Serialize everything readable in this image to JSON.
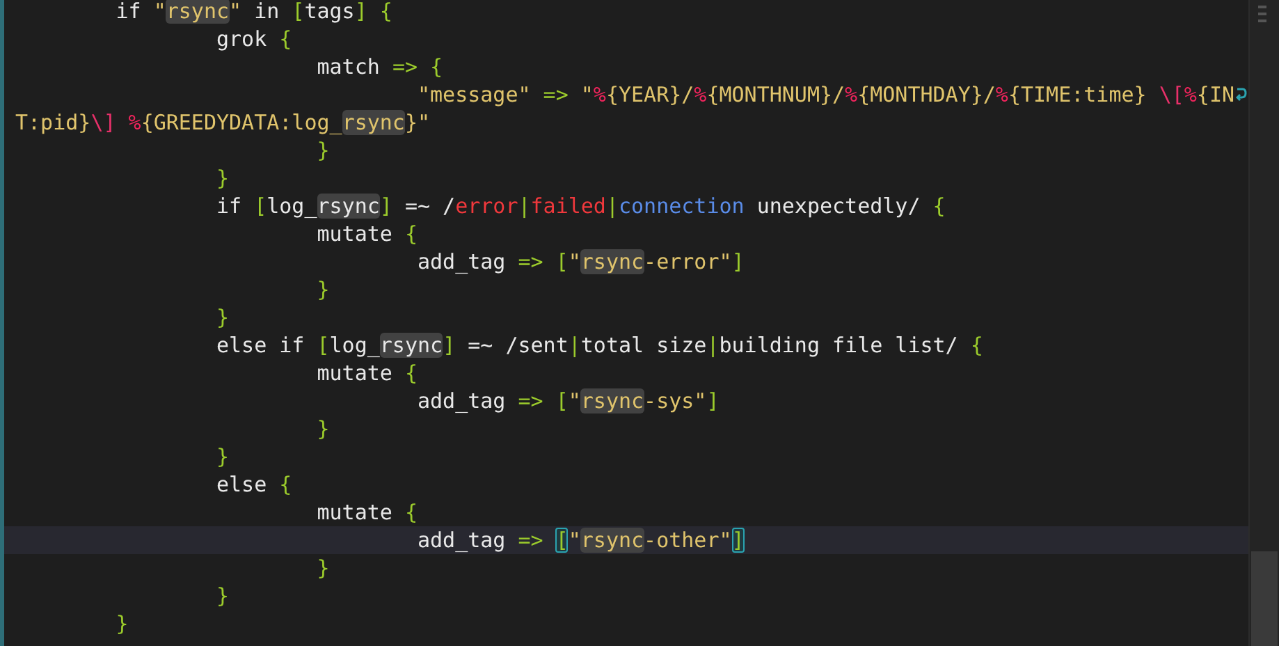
{
  "editor": {
    "lines": [
      {
        "segments": [
          {
            "text": "\tif ",
            "kind": "plain"
          },
          {
            "text": "\"",
            "kind": "string"
          },
          {
            "text": "rsync",
            "kind": "string",
            "highlight": true
          },
          {
            "text": "\"",
            "kind": "string"
          },
          {
            "text": " in ",
            "kind": "plain"
          },
          {
            "text": "[",
            "kind": "punct"
          },
          {
            "text": "tags",
            "kind": "plain"
          },
          {
            "text": "]",
            "kind": "punct"
          },
          {
            "text": " {",
            "kind": "punct"
          }
        ]
      },
      {
        "segments": [
          {
            "text": "\t\tgrok ",
            "kind": "plain"
          },
          {
            "text": "{",
            "kind": "punct"
          }
        ]
      },
      {
        "segments": [
          {
            "text": "\t\t\tmatch ",
            "kind": "plain"
          },
          {
            "text": "=>",
            "kind": "punct"
          },
          {
            "text": " {",
            "kind": "punct"
          }
        ]
      },
      {
        "wrapped": true,
        "segments": [
          {
            "text": "\t\t\t\t\"message\"",
            "kind": "string"
          },
          {
            "text": " =>",
            "kind": "punct"
          },
          {
            "text": " \"",
            "kind": "string"
          },
          {
            "text": "%",
            "kind": "percent"
          },
          {
            "text": "{YEAR}/",
            "kind": "string"
          },
          {
            "text": "%",
            "kind": "percent"
          },
          {
            "text": "{MONTHNUM}/",
            "kind": "string"
          },
          {
            "text": "%",
            "kind": "percent"
          },
          {
            "text": "{MONTHDAY}/",
            "kind": "string"
          },
          {
            "text": "%",
            "kind": "percent"
          },
          {
            "text": "{TIME:time} ",
            "kind": "string"
          },
          {
            "text": "\\[",
            "kind": "escape"
          },
          {
            "text": "%",
            "kind": "percent"
          },
          {
            "text": "{IN",
            "kind": "string"
          }
        ]
      },
      {
        "segments": [
          {
            "text": "T:pid}",
            "kind": "string"
          },
          {
            "text": "\\]",
            "kind": "escape"
          },
          {
            "text": " %",
            "kind": "percent"
          },
          {
            "text": "{GREEDYDATA:log_",
            "kind": "string"
          },
          {
            "text": "rsync",
            "kind": "string",
            "highlight": true
          },
          {
            "text": "}\"",
            "kind": "string"
          }
        ]
      },
      {
        "segments": [
          {
            "text": "\t\t\t}",
            "kind": "punct"
          }
        ]
      },
      {
        "segments": [
          {
            "text": "\t\t}",
            "kind": "punct"
          }
        ]
      },
      {
        "segments": [
          {
            "text": "\t\tif ",
            "kind": "plain"
          },
          {
            "text": "[",
            "kind": "punct"
          },
          {
            "text": "log_",
            "kind": "plain"
          },
          {
            "text": "rsync",
            "kind": "plain",
            "highlight": true
          },
          {
            "text": "]",
            "kind": "punct"
          },
          {
            "text": " =~ /",
            "kind": "plain"
          },
          {
            "text": "error",
            "kind": "error"
          },
          {
            "text": "|",
            "kind": "punct"
          },
          {
            "text": "failed",
            "kind": "error"
          },
          {
            "text": "|",
            "kind": "punct"
          },
          {
            "text": "connection",
            "kind": "alt"
          },
          {
            "text": " unexpectedly/ ",
            "kind": "plain"
          },
          {
            "text": "{",
            "kind": "punct"
          }
        ]
      },
      {
        "segments": [
          {
            "text": "\t\t\tmutate ",
            "kind": "plain"
          },
          {
            "text": "{",
            "kind": "punct"
          }
        ]
      },
      {
        "segments": [
          {
            "text": "\t\t\t\tadd_tag ",
            "kind": "plain"
          },
          {
            "text": "=>",
            "kind": "punct"
          },
          {
            "text": " [",
            "kind": "punct"
          },
          {
            "text": "\"",
            "kind": "string"
          },
          {
            "text": "rsync",
            "kind": "string",
            "highlight": true
          },
          {
            "text": "-error\"",
            "kind": "string"
          },
          {
            "text": "]",
            "kind": "punct"
          }
        ]
      },
      {
        "segments": [
          {
            "text": "\t\t\t}",
            "kind": "punct"
          }
        ]
      },
      {
        "segments": [
          {
            "text": "\t\t}",
            "kind": "punct"
          }
        ]
      },
      {
        "segments": [
          {
            "text": "\t\telse if ",
            "kind": "plain"
          },
          {
            "text": "[",
            "kind": "punct"
          },
          {
            "text": "log_",
            "kind": "plain"
          },
          {
            "text": "rsync",
            "kind": "plain",
            "highlight": true
          },
          {
            "text": "]",
            "kind": "punct"
          },
          {
            "text": " =~ /sent",
            "kind": "plain"
          },
          {
            "text": "|",
            "kind": "punct"
          },
          {
            "text": "total size",
            "kind": "plain"
          },
          {
            "text": "|",
            "kind": "punct"
          },
          {
            "text": "building file list/ ",
            "kind": "plain"
          },
          {
            "text": "{",
            "kind": "punct"
          }
        ]
      },
      {
        "segments": [
          {
            "text": "\t\t\tmutate ",
            "kind": "plain"
          },
          {
            "text": "{",
            "kind": "punct"
          }
        ]
      },
      {
        "segments": [
          {
            "text": "\t\t\t\tadd_tag ",
            "kind": "plain"
          },
          {
            "text": "=>",
            "kind": "punct"
          },
          {
            "text": " [",
            "kind": "punct"
          },
          {
            "text": "\"",
            "kind": "string"
          },
          {
            "text": "rsync",
            "kind": "string",
            "highlight": true
          },
          {
            "text": "-sys\"",
            "kind": "string"
          },
          {
            "text": "]",
            "kind": "punct"
          }
        ]
      },
      {
        "segments": [
          {
            "text": "\t\t\t}",
            "kind": "punct"
          }
        ]
      },
      {
        "segments": [
          {
            "text": "\t\t}",
            "kind": "punct"
          }
        ]
      },
      {
        "segments": [
          {
            "text": "\t\telse ",
            "kind": "plain"
          },
          {
            "text": "{",
            "kind": "punct"
          }
        ]
      },
      {
        "segments": [
          {
            "text": "\t\t\tmutate ",
            "kind": "plain"
          },
          {
            "text": "{",
            "kind": "punct"
          }
        ]
      },
      {
        "current": true,
        "segments": [
          {
            "text": "\t\t\t\tadd_tag ",
            "kind": "plain"
          },
          {
            "text": "=> ",
            "kind": "punct"
          },
          {
            "text": "[",
            "kind": "punct",
            "matched": true
          },
          {
            "text": "\"",
            "kind": "string"
          },
          {
            "text": "rsync",
            "kind": "string",
            "highlight": true
          },
          {
            "text": "-other\"",
            "kind": "string"
          },
          {
            "text": "]",
            "kind": "punct",
            "matched": true
          }
        ]
      },
      {
        "segments": [
          {
            "text": "\t\t\t}",
            "kind": "punct"
          }
        ]
      },
      {
        "segments": [
          {
            "text": "\t\t}",
            "kind": "punct"
          }
        ]
      },
      {
        "segments": [
          {
            "text": "\t}",
            "kind": "punct"
          }
        ]
      }
    ]
  }
}
